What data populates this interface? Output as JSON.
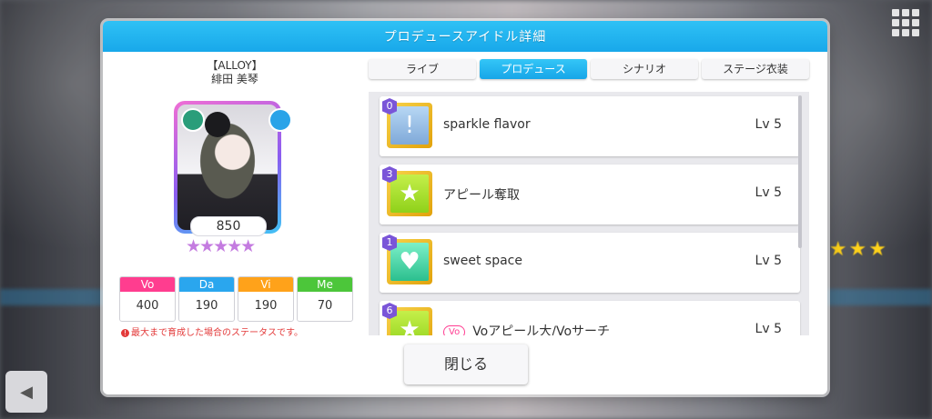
{
  "dialog": {
    "title": "プロデュースアイドル詳細",
    "close_label": "閉じる"
  },
  "idol": {
    "unit": "【ALLOY】",
    "name": "緋田 美琴",
    "fans": "850",
    "rank_stars": "★★★★★"
  },
  "stats": [
    {
      "label": "Vo",
      "value": "400",
      "color": "#ff3d8f"
    },
    {
      "label": "Da",
      "value": "190",
      "color": "#2aa6ee"
    },
    {
      "label": "Vi",
      "value": "190",
      "color": "#ffa21a"
    },
    {
      "label": "Me",
      "value": "70",
      "color": "#4cc63a"
    }
  ],
  "note": "最大まで育成した場合のステータスです。",
  "tabs": [
    {
      "label": "ライブ",
      "active": false
    },
    {
      "label": "プロデュース",
      "active": true
    },
    {
      "label": "シナリオ",
      "active": false
    },
    {
      "label": "ステージ衣装",
      "active": false
    }
  ],
  "skills": [
    {
      "num": "0",
      "name": "sparkle flavor",
      "level": "Lv 5",
      "icon": "exclamation-icon",
      "tag": ""
    },
    {
      "num": "3",
      "name": "アピール奪取",
      "level": "Lv 5",
      "icon": "star-icon",
      "tag": ""
    },
    {
      "num": "1",
      "name": "sweet space",
      "level": "Lv 5",
      "icon": "heart-icon",
      "tag": ""
    },
    {
      "num": "6",
      "name": "Voアピール大/Voサーチ",
      "level": "Lv 5",
      "icon": "star-icon",
      "tag": "Vo"
    }
  ]
}
